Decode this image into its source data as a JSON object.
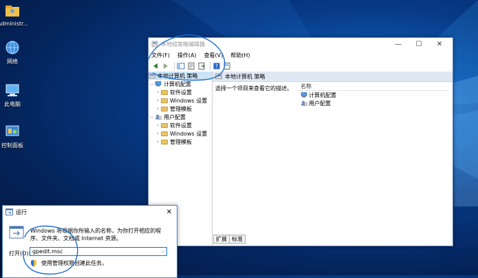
{
  "desktop": {
    "icons": [
      {
        "label": "Administr...",
        "icon": "user-folder-icon"
      },
      {
        "label": "网络",
        "icon": "network-icon"
      },
      {
        "label": "此电脑",
        "icon": "computer-icon"
      },
      {
        "label": "控制面板",
        "icon": "control-panel-icon"
      }
    ]
  },
  "gpedit": {
    "title": "本地组策略编辑器",
    "menu": [
      "文件(F)",
      "操作(A)",
      "查看(V)",
      "帮助(H)"
    ],
    "tree": {
      "root": "本地计算机 策略",
      "computer_config": "计算机配置",
      "user_config": "用户配置",
      "computer_children": [
        "软件设置",
        "Windows 设置",
        "管理模板"
      ],
      "user_children": [
        "软件设置",
        "Windows 设置",
        "管理模板"
      ]
    },
    "right_header": "本地计算机 策略",
    "description": "选择一个项目来查看它的描述。",
    "list_header": "名称",
    "list_items": [
      "计算机配置",
      "用户配置"
    ],
    "tabs": [
      "扩展",
      "标准"
    ]
  },
  "run": {
    "title": "运行",
    "description": "Windows 将根据你所输入的名称，为你打开相应的程序、文件夹、文档或 Internet 资源。",
    "open_label": "打开(O):",
    "input_value": "gpedit.msc",
    "admin_text": "使用管理权限创建此任务。"
  },
  "colors": {
    "accent": "#0078d7",
    "selection": "#cce4f7",
    "scribble": "#1e6fd0",
    "header_band": "#dfe8f5"
  }
}
